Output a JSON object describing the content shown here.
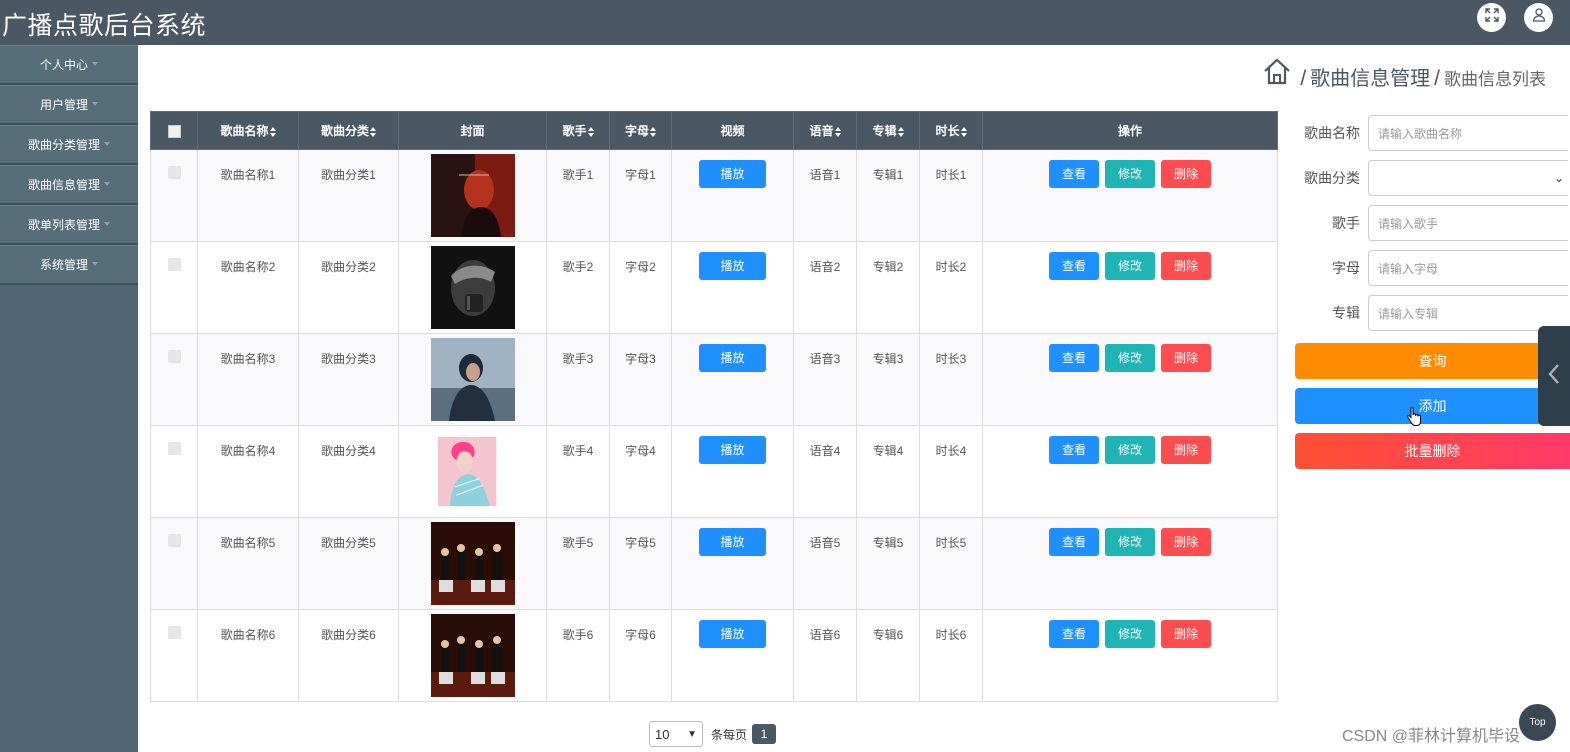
{
  "header": {
    "title": "广播点歌后台系统",
    "icons": [
      "fullscreen-icon",
      "user-icon"
    ]
  },
  "sidebar": {
    "items": [
      {
        "label": "个人中心"
      },
      {
        "label": "用户管理"
      },
      {
        "label": "歌曲分类管理"
      },
      {
        "label": "歌曲信息管理"
      },
      {
        "label": "歌单列表管理"
      },
      {
        "label": "系统管理"
      }
    ]
  },
  "breadcrumb": {
    "level1": "歌曲信息管理",
    "level2": "歌曲信息列表",
    "separator": "/"
  },
  "table": {
    "headers": {
      "name": "歌曲名称",
      "category": "歌曲分类",
      "cover": "封面",
      "singer": "歌手",
      "letter": "字母",
      "video": "视频",
      "language": "语音",
      "album": "专辑",
      "duration": "时长",
      "ops": "操作"
    },
    "rows": [
      {
        "name": "歌曲名称1",
        "category": "歌曲分类1",
        "singer": "歌手1",
        "letter": "字母1",
        "language": "语音1",
        "album": "专辑1",
        "duration": "时长1"
      },
      {
        "name": "歌曲名称2",
        "category": "歌曲分类2",
        "singer": "歌手2",
        "letter": "字母2",
        "language": "语音2",
        "album": "专辑2",
        "duration": "时长2"
      },
      {
        "name": "歌曲名称3",
        "category": "歌曲分类3",
        "singer": "歌手3",
        "letter": "字母3",
        "language": "语音3",
        "album": "专辑3",
        "duration": "时长3"
      },
      {
        "name": "歌曲名称4",
        "category": "歌曲分类4",
        "singer": "歌手4",
        "letter": "字母4",
        "language": "语音4",
        "album": "专辑4",
        "duration": "时长4"
      },
      {
        "name": "歌曲名称5",
        "category": "歌曲分类5",
        "singer": "歌手5",
        "letter": "字母5",
        "language": "语音5",
        "album": "专辑5",
        "duration": "时长5"
      },
      {
        "name": "歌曲名称6",
        "category": "歌曲分类6",
        "singer": "歌手6",
        "letter": "字母6",
        "language": "语音6",
        "album": "专辑6",
        "duration": "时长6"
      }
    ],
    "play_label": "播放",
    "view_label": "查看",
    "edit_label": "修改",
    "delete_label": "删除"
  },
  "pagination": {
    "page_size": "10",
    "per_page_label": "条每页",
    "current_page": "1"
  },
  "search": {
    "name_label": "歌曲名称",
    "name_placeholder": "请输入歌曲名称",
    "category_label": "歌曲分类",
    "category_value": "",
    "singer_label": "歌手",
    "singer_placeholder": "请输入歌手",
    "letter_label": "字母",
    "letter_placeholder": "请输入字母",
    "album_label": "专辑",
    "album_placeholder": "请输入专辑",
    "query_label": "查询",
    "add_label": "添加",
    "batch_delete_label": "批量删除"
  },
  "top_button": "Top",
  "watermark": "CSDN @菲林计算机毕设",
  "colors": {
    "header_bg": "#4a5866",
    "sidebar_bg": "#566d7a",
    "primary": "#1e90ff",
    "success": "#1fb5b5",
    "danger": "#ff4d4f",
    "warning": "#ff8c00"
  }
}
